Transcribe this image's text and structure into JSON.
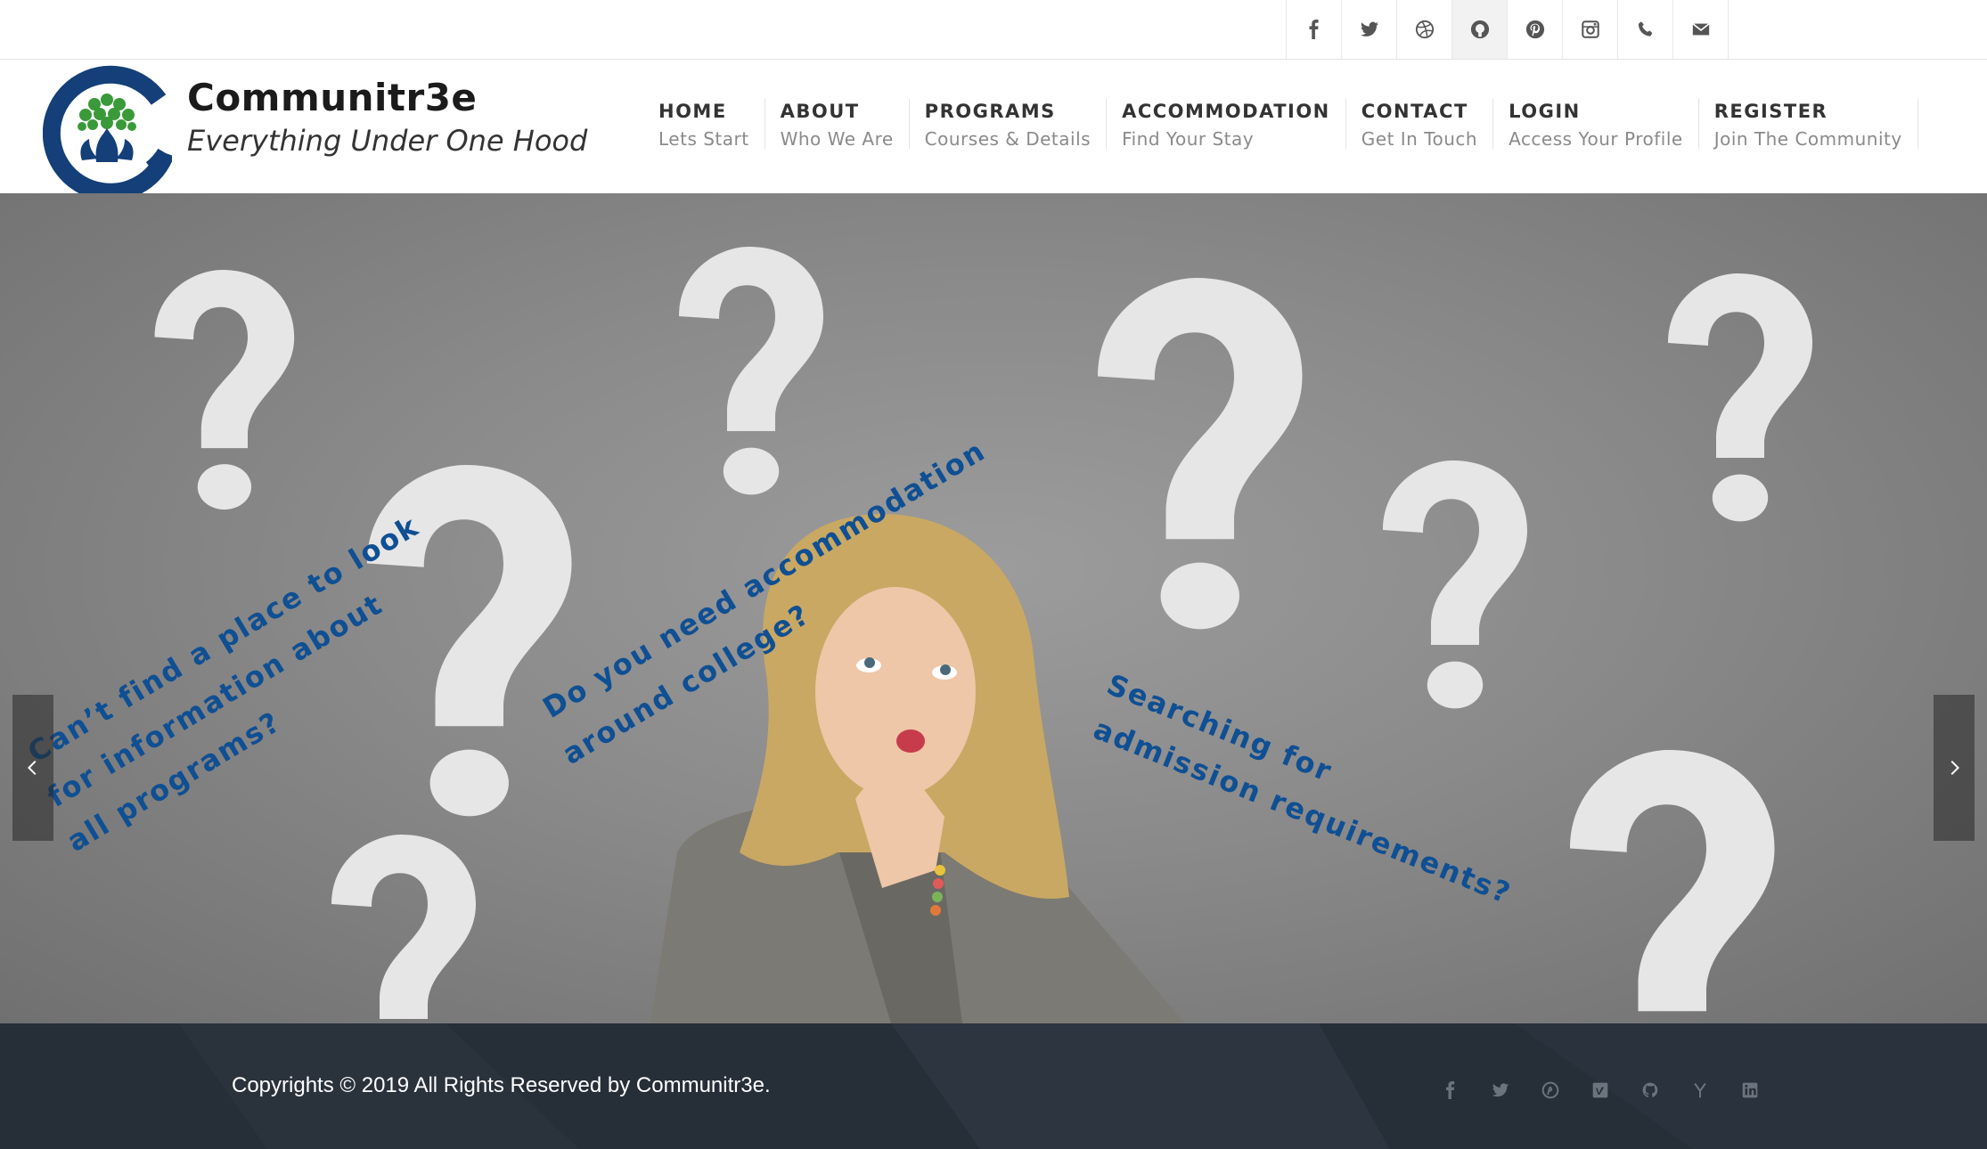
{
  "topbar": {
    "social": [
      {
        "icon": "facebook-icon"
      },
      {
        "icon": "twitter-icon"
      },
      {
        "icon": "dribbble-icon"
      },
      {
        "icon": "github-icon",
        "active": true
      },
      {
        "icon": "pinterest-icon"
      },
      {
        "icon": "instagram-icon"
      },
      {
        "icon": "phone-icon"
      },
      {
        "icon": "email-icon"
      }
    ]
  },
  "brand": {
    "name": "Communitr3e",
    "tagline": "Everything Under One Hood",
    "colors": {
      "navy": "#143f78",
      "green": "#3a9a3a"
    }
  },
  "nav": [
    {
      "label": "HOME",
      "sub": "Lets Start"
    },
    {
      "label": "ABOUT",
      "sub": "Who We Are"
    },
    {
      "label": "PROGRAMS",
      "sub": "Courses & Details"
    },
    {
      "label": "ACCOMMODATION",
      "sub": "Find Your Stay"
    },
    {
      "label": "CONTACT",
      "sub": "Get In Touch"
    },
    {
      "label": "LOGIN",
      "sub": "Access Your Profile"
    },
    {
      "label": "REGISTER",
      "sub": "Join The Community"
    }
  ],
  "hero": {
    "text_color": "#0f4f93",
    "captions": {
      "left": [
        "Can’t find a place to look",
        "for information about",
        "all programs?"
      ],
      "middle": [
        "Do you need accommodation",
        "around college?"
      ],
      "right": [
        "Searching for",
        "admission requirements?"
      ]
    },
    "prev_icon": "chevron-left-icon",
    "next_icon": "chevron-right-icon"
  },
  "footer": {
    "copyright": "Copyrights © 2019 All Rights Reserved by Communitr3e.",
    "social": [
      {
        "icon": "facebook-icon"
      },
      {
        "icon": "twitter-icon"
      },
      {
        "icon": "pinterest-icon"
      },
      {
        "icon": "vimeo-icon"
      },
      {
        "icon": "github-icon"
      },
      {
        "icon": "hacker-news-icon"
      },
      {
        "icon": "linkedin-icon"
      }
    ]
  }
}
